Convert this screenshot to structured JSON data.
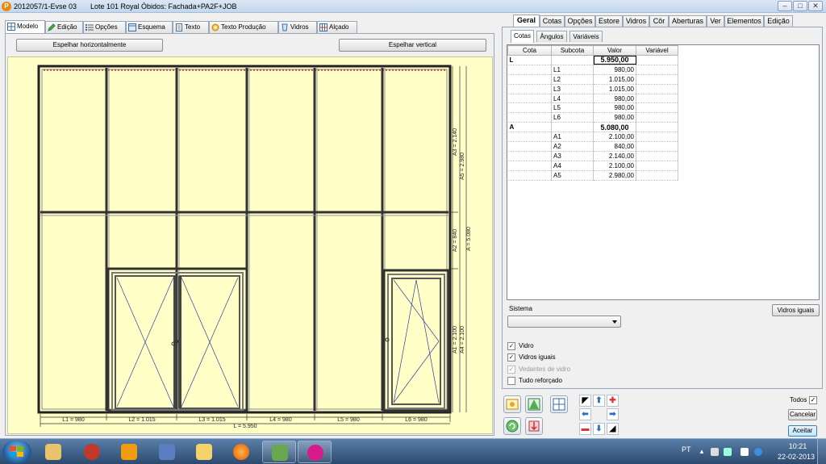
{
  "window": {
    "app_title": "2012057/1-Evse 03",
    "doc_title": "Lote 101 Royal Óbidos: Fachada+PA2F+JOB",
    "controls": {
      "minimize": "–",
      "maximize": "□",
      "close": "✕"
    }
  },
  "left_tabs": [
    {
      "label": "Modelo",
      "icon": "grid-icon",
      "active": true
    },
    {
      "label": "Edição",
      "icon": "pencil-icon"
    },
    {
      "label": "Opções",
      "icon": "list-icon"
    },
    {
      "label": "Esquema",
      "icon": "schema-icon"
    },
    {
      "label": "Texto",
      "icon": "document-icon"
    },
    {
      "label": "Texto Produção",
      "icon": "gear-document-icon"
    },
    {
      "label": "Vidros",
      "icon": "glass-icon"
    },
    {
      "label": "Alçado",
      "icon": "elevation-icon"
    }
  ],
  "mirror": {
    "horizontal": "Espelhar horizontalmente",
    "vertical": "Espelhar vertical"
  },
  "drawing": {
    "bottom_dims": [
      "L1 = 980",
      "L2 = 1.015",
      "L3 = 1.015",
      "L4 = 980",
      "L5 = 980",
      "L6 = 980"
    ],
    "total_width": "L = 5.950",
    "right_dims": {
      "a3": "A3 = 2.140",
      "a5": "A5 = 2.980",
      "a2": "A2 = 840",
      "a": "A = 5.080",
      "a1": "A1 = 2.100",
      "a4": "A4 = 2.100"
    }
  },
  "right_tabs": [
    "Geral",
    "Cotas",
    "Opções",
    "Estore",
    "Vidros",
    "Côr",
    "Aberturas",
    "Ver",
    "Elementos",
    "Edição"
  ],
  "right_tab_active": "Geral",
  "sub_tabs": [
    "Cotas",
    "Ângulos",
    "Variáveis"
  ],
  "sub_tab_active": "Cotas",
  "table": {
    "headers": [
      "Cota",
      "Subcota",
      "Valor",
      "Variável"
    ],
    "rows": [
      {
        "cota": "L",
        "subcota": "",
        "valor": "5.950,00",
        "group": true,
        "selected": true
      },
      {
        "cota": "",
        "subcota": "L1",
        "valor": "980,00"
      },
      {
        "cota": "",
        "subcota": "L2",
        "valor": "1.015,00"
      },
      {
        "cota": "",
        "subcota": "L3",
        "valor": "1.015,00"
      },
      {
        "cota": "",
        "subcota": "L4",
        "valor": "980,00"
      },
      {
        "cota": "",
        "subcota": "L5",
        "valor": "980,00"
      },
      {
        "cota": "",
        "subcota": "L6",
        "valor": "980,00"
      },
      {
        "cota": "A",
        "subcota": "",
        "valor": "5.080,00",
        "group": true
      },
      {
        "cota": "",
        "subcota": "A1",
        "valor": "2.100,00"
      },
      {
        "cota": "",
        "subcota": "A2",
        "valor": "840,00"
      },
      {
        "cota": "",
        "subcota": "A3",
        "valor": "2.140,00"
      },
      {
        "cota": "",
        "subcota": "A4",
        "valor": "2.100,00"
      },
      {
        "cota": "",
        "subcota": "A5",
        "valor": "2.980,00"
      }
    ]
  },
  "sistema": {
    "label": "Sistema",
    "value": ""
  },
  "vidros_iguais_button": "Vidros iguais",
  "checkboxes": [
    {
      "label": "Vidro",
      "checked": true,
      "disabled": false
    },
    {
      "label": "Vidros iguais",
      "checked": true,
      "disabled": false
    },
    {
      "label": "Vedantes de vidro",
      "checked": true,
      "disabled": true
    },
    {
      "label": "Tudo reforçado",
      "checked": false,
      "disabled": false
    }
  ],
  "todos": {
    "label": "Todos",
    "checked": true
  },
  "actions": {
    "cancel": "Cancelar",
    "ok": "Aceitar"
  },
  "taskbar": {
    "language": "PT",
    "time": "10:21",
    "date": "22-02-2013",
    "apps": [
      "folder-icon",
      "network-icon",
      "media-icon",
      "tools-icon",
      "mail-icon",
      "firefox-icon",
      "users-icon",
      "software-icon"
    ]
  }
}
